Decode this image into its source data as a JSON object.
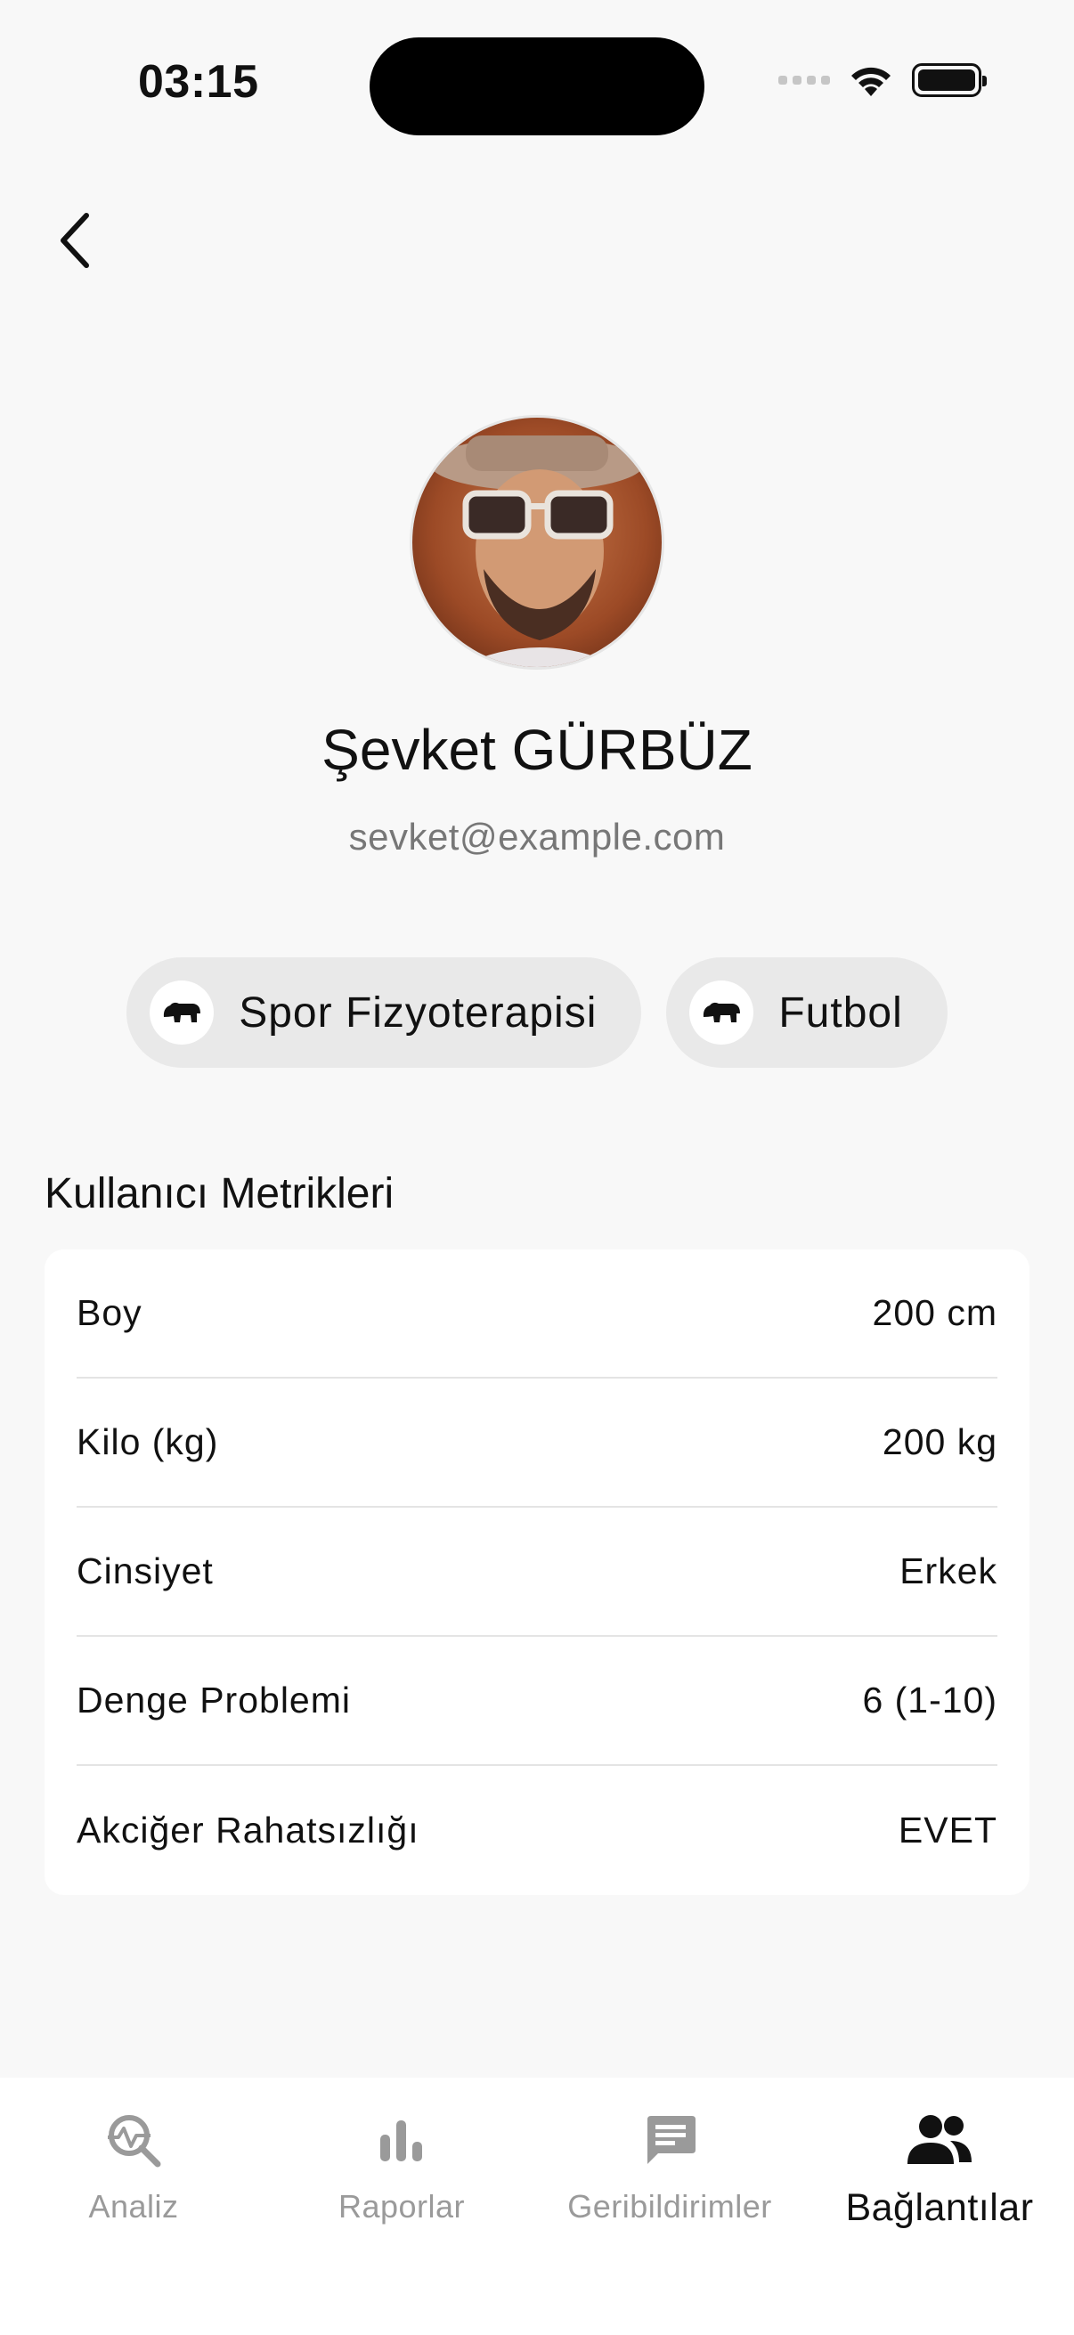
{
  "status_bar": {
    "time": "03:15"
  },
  "header": {
    "back_icon": "chevron-left-icon"
  },
  "profile": {
    "name": "Şevket GÜRBÜZ",
    "email": "sevket@example.com",
    "avatar": "avatar-photo"
  },
  "chips": [
    {
      "label": "Spor Fizyoterapisi",
      "icon": "bear-icon"
    },
    {
      "label": "Futbol",
      "icon": "bear-icon"
    }
  ],
  "metrics": {
    "title": "Kullanıcı Metrikleri",
    "rows": [
      {
        "label": "Boy",
        "value": "200 cm"
      },
      {
        "label": "Kilo (kg)",
        "value": "200 kg"
      },
      {
        "label": "Cinsiyet",
        "value": "Erkek"
      },
      {
        "label": "Denge Problemi",
        "value": "6 (1-10)"
      },
      {
        "label": "Akciğer Rahatsızlığı",
        "value": "EVET"
      }
    ]
  },
  "nav": {
    "items": [
      {
        "label": "Analiz",
        "icon": "analysis-search-icon",
        "active": false
      },
      {
        "label": "Raporlar",
        "icon": "bar-chart-icon",
        "active": false
      },
      {
        "label": "Geribildirimler",
        "icon": "chat-message-icon",
        "active": false
      },
      {
        "label": "Bağlantılar",
        "icon": "people-icon",
        "active": true
      }
    ]
  },
  "colors": {
    "background": "#f8f8f8",
    "card": "#ffffff",
    "chip": "#e9e9e9",
    "inactive": "#9a9a9a",
    "active": "#111111"
  }
}
